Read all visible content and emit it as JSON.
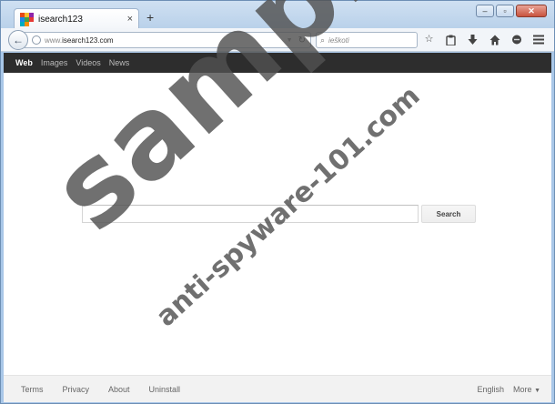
{
  "browser": {
    "tab_title": "isearch123",
    "tab_close": "×",
    "new_tab": "+",
    "url_prefix": "www.",
    "url_domain": "isearch123.com",
    "search_placeholder": "ieškoti",
    "window_controls": {
      "minimize": "–",
      "maximize": "▫",
      "close": "✕"
    },
    "toolbar_icons": [
      "star-icon",
      "clipboard-icon",
      "download-icon",
      "home-icon",
      "chat-icon",
      "menu-icon"
    ]
  },
  "page": {
    "nav": [
      "Web",
      "Images",
      "Videos",
      "News"
    ],
    "search_button": "Search",
    "search_placeholder": "",
    "footer_left": [
      "Terms",
      "Privacy",
      "About",
      "Uninstall"
    ],
    "footer_language": "English",
    "footer_more": "More"
  },
  "watermark": {
    "main": "sample",
    "sub": "anti-spyware-101.com"
  },
  "colors": {
    "gbar_bg": "#2d2d2d",
    "frame": "#a9c7e8",
    "watermark": "#505050"
  }
}
